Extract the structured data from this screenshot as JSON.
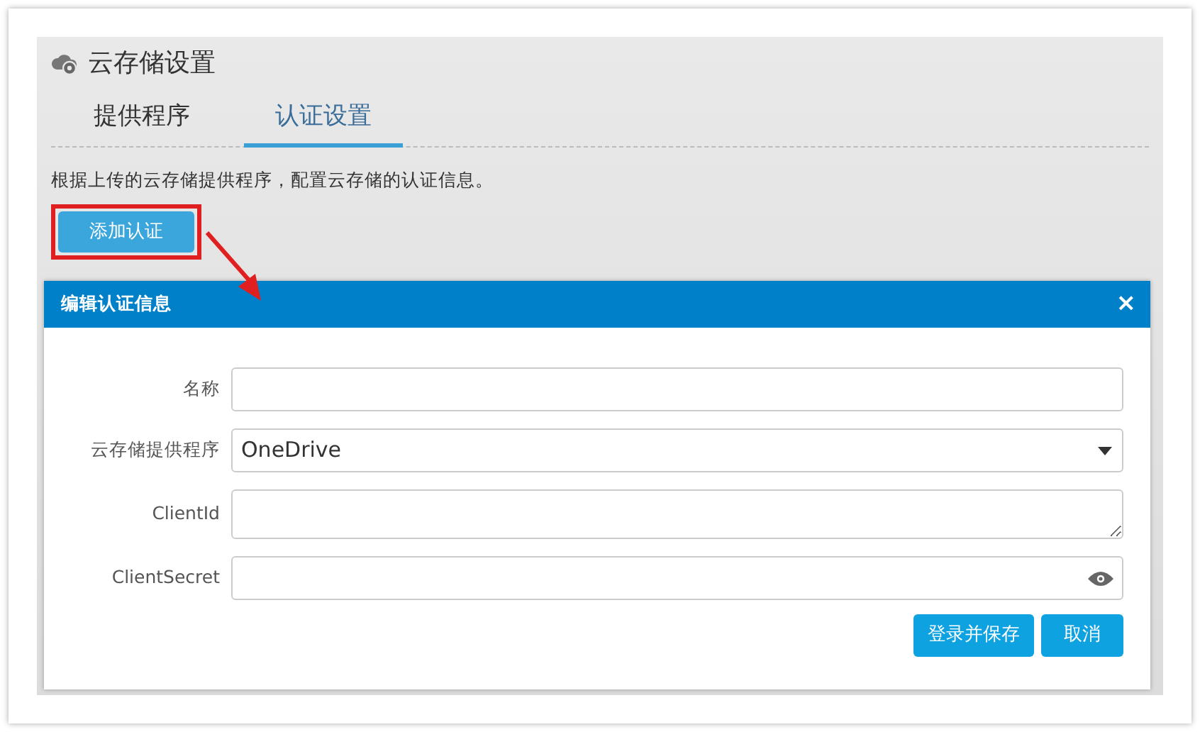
{
  "page": {
    "title": "云存储设置",
    "tabs": [
      {
        "label": "提供程序",
        "selected": false
      },
      {
        "label": "认证设置",
        "selected": true
      }
    ],
    "description": "根据上传的云存储提供程序，配置云存储的认证信息。",
    "add_button": "添加认证"
  },
  "dialog": {
    "title": "编辑认证信息",
    "close": "×",
    "fields": [
      {
        "label": "名称",
        "kind": "text"
      },
      {
        "label": "云存储提供程序",
        "kind": "select",
        "value": "OneDrive"
      },
      {
        "label": "ClientId",
        "kind": "textarea"
      },
      {
        "label": "ClientSecret",
        "kind": "password"
      }
    ],
    "buttons": [
      "登录并保存",
      "取消"
    ]
  }
}
